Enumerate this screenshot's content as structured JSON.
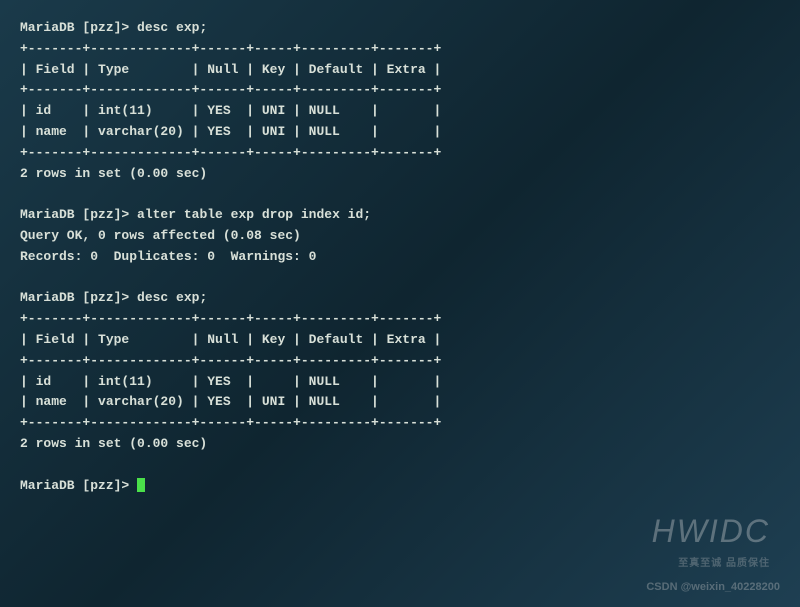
{
  "prompt1": "MariaDB [pzz]> ",
  "cmd1": "desc exp;",
  "table1_border_top": "+-------+-------------+------+-----+---------+-------+",
  "table1_header": "| Field | Type        | Null | Key | Default | Extra |",
  "table1_border_mid": "+-------+-------------+------+-----+---------+-------+",
  "table1_row1": "| id    | int(11)     | YES  | UNI | NULL    |       |",
  "table1_row2": "| name  | varchar(20) | YES  | UNI | NULL    |       |",
  "table1_border_bot": "+-------+-------------+------+-----+---------+-------+",
  "result1": "2 rows in set (0.00 sec)",
  "prompt2": "MariaDB [pzz]> ",
  "cmd2": "alter table exp drop index id;",
  "result2a": "Query OK, 0 rows affected (0.08 sec)",
  "result2b": "Records: 0  Duplicates: 0  Warnings: 0",
  "prompt3": "MariaDB [pzz]> ",
  "cmd3": "desc exp;",
  "table2_border_top": "+-------+-------------+------+-----+---------+-------+",
  "table2_header": "| Field | Type        | Null | Key | Default | Extra |",
  "table2_border_mid": "+-------+-------------+------+-----+---------+-------+",
  "table2_row1": "| id    | int(11)     | YES  |     | NULL    |       |",
  "table2_row2": "| name  | varchar(20) | YES  | UNI | NULL    |       |",
  "table2_border_bot": "+-------+-------------+------+-----+---------+-------+",
  "result3": "2 rows in set (0.00 sec)",
  "prompt4": "MariaDB [pzz]> ",
  "watermark_brand": "HWIDC",
  "watermark_sub": "至真至诚 品质保住",
  "watermark_csdn": "CSDN @weixin_40228200"
}
